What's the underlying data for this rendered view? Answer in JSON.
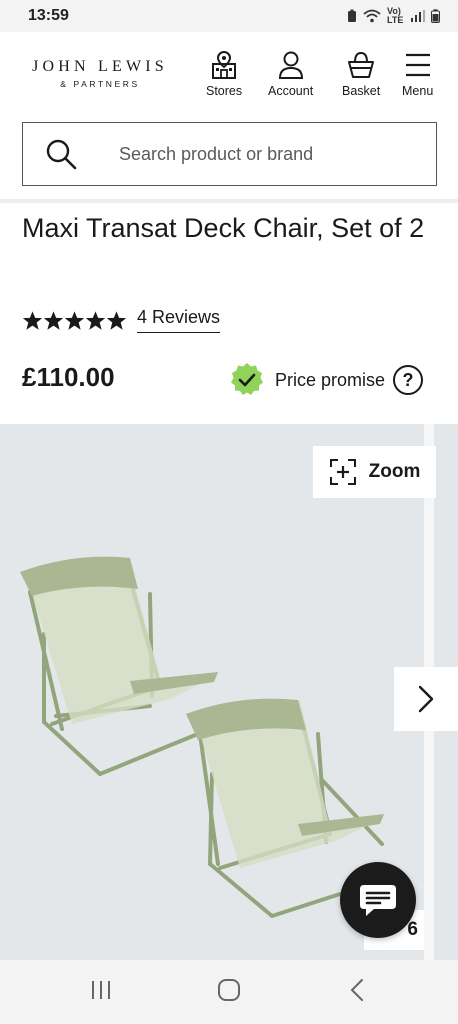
{
  "status_bar": {
    "time": "13:59",
    "network": "Vo) LTE"
  },
  "header": {
    "logo_line1": "JOHN LEWIS",
    "logo_line2": "& PARTNERS",
    "nav": [
      {
        "label": "Stores",
        "icon": "store-icon"
      },
      {
        "label": "Account",
        "icon": "person-icon"
      },
      {
        "label": "Basket",
        "icon": "basket-icon"
      },
      {
        "label": "Menu",
        "icon": "hamburger-icon"
      }
    ]
  },
  "search": {
    "placeholder": "Search product or brand"
  },
  "product": {
    "title": "Maxi Transat Deck Chair, Set of 2",
    "rating": 5,
    "reviews_label": "4 Reviews",
    "price": "£110.00",
    "price_promise": "Price promise",
    "help": "?"
  },
  "gallery": {
    "zoom_label": "Zoom",
    "counter": "6",
    "chair_color": "#a9b892"
  },
  "colors": {
    "promise_badge": "#8fd35a",
    "gallery_bg": "#e4e7ea",
    "chat_button": "#1b1b1b"
  }
}
